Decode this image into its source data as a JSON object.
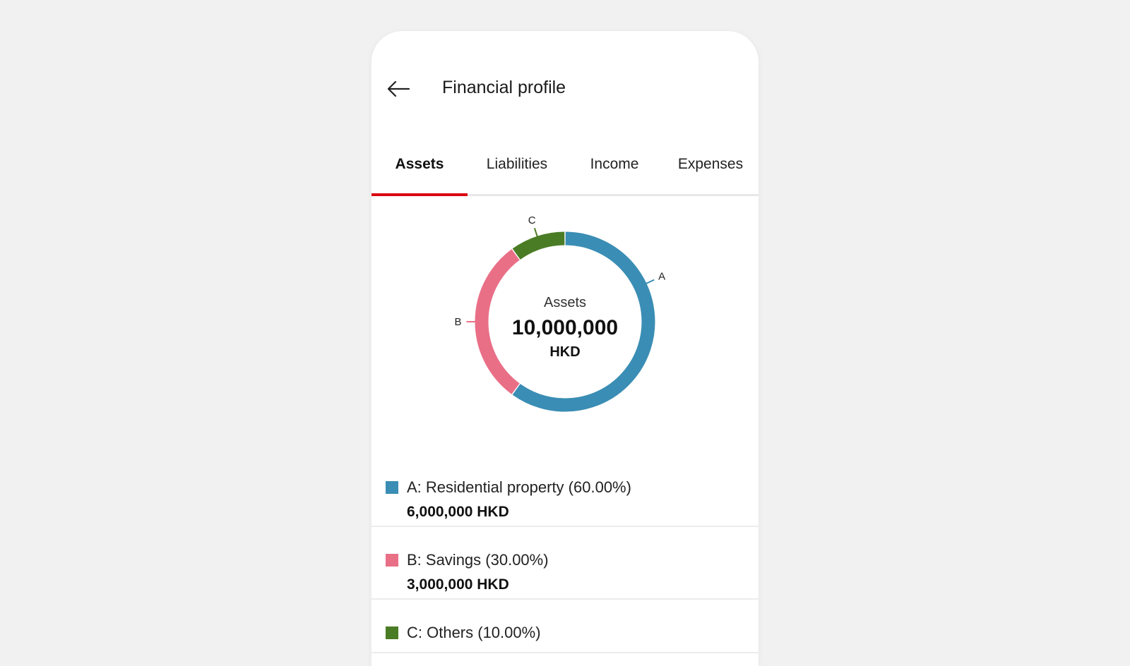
{
  "header": {
    "back_icon": "arrow-left-icon",
    "title": "Financial profile"
  },
  "tabs": [
    {
      "label": "Assets",
      "active": true
    },
    {
      "label": "Liabilities",
      "active": false
    },
    {
      "label": "Income",
      "active": false
    },
    {
      "label": "Expenses",
      "active": false
    }
  ],
  "accent_color": "#db0011",
  "chart_data": {
    "type": "pie",
    "variant": "donut",
    "center_label": "Assets",
    "center_value": "10,000,000",
    "center_unit": "HKD",
    "slices": [
      {
        "label": "A",
        "value": 60.0,
        "color": "#3a8db4"
      },
      {
        "label": "B",
        "value": 30.0,
        "color": "#e96f87"
      },
      {
        "label": "C",
        "value": 10.0,
        "color": "#4a7c25"
      }
    ]
  },
  "legend": [
    {
      "label": "A: Residential property (60.00%)",
      "amount": "6,000,000 HKD",
      "color": "#3a8db4"
    },
    {
      "label": "B: Savings (30.00%)",
      "amount": "3,000,000 HKD",
      "color": "#e96f87"
    },
    {
      "label": "C: Others (10.00%)",
      "amount": "",
      "color": "#4a7c25"
    }
  ]
}
